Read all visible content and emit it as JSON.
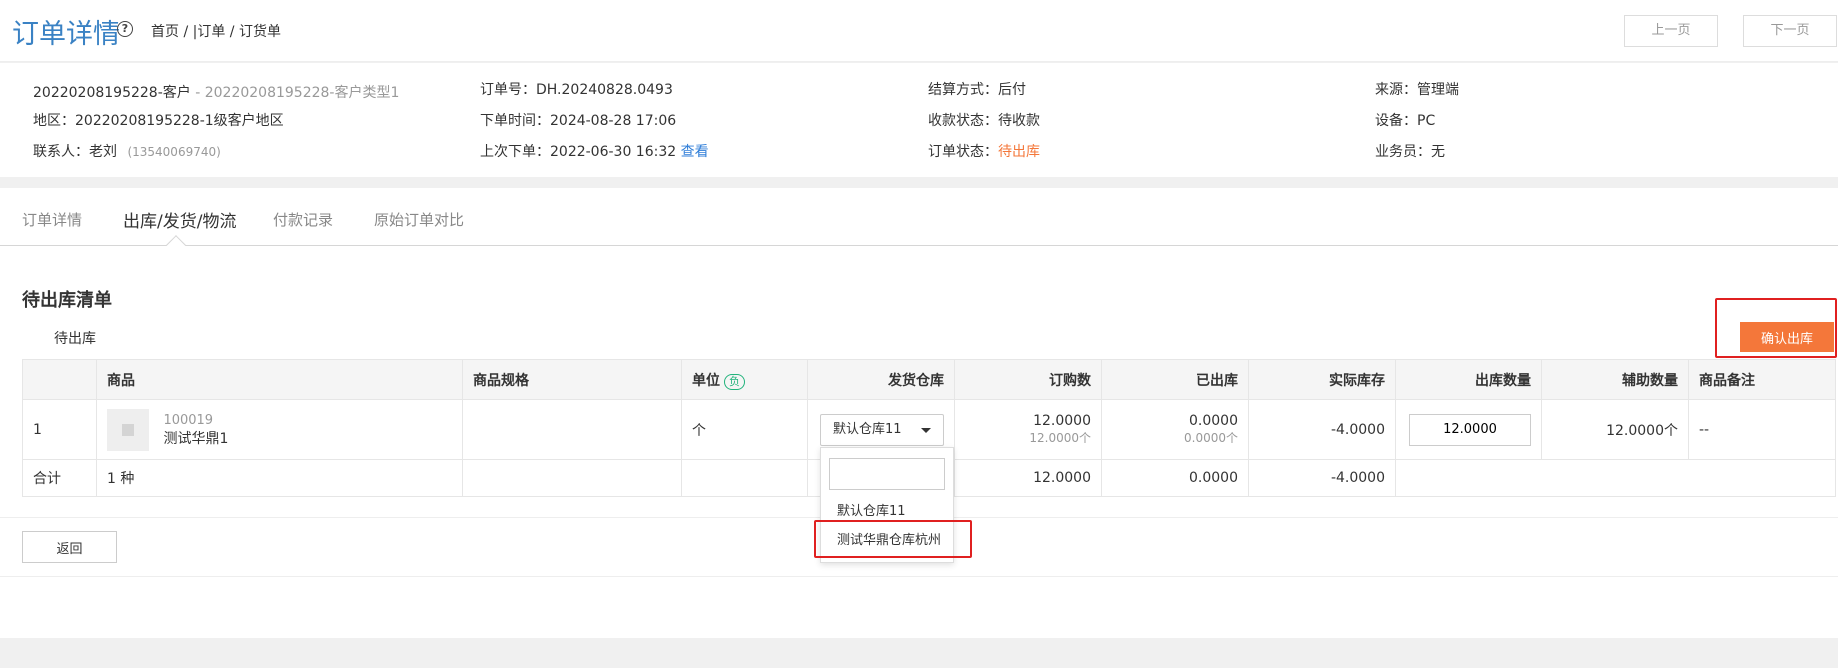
{
  "header": {
    "title": "订单详情",
    "breadcrumb": "首页 / |订单 / 订货单",
    "prev_label": "上一页",
    "next_label": "下一页"
  },
  "info": {
    "customer": "20220208195228-客户",
    "customer_type": " - 20220208195228-客户类型1",
    "region": "地区：20220208195228-1级客户地区",
    "contact_label": "联系人：老刘",
    "contact_phone": "(13540069740)",
    "order_no": "订单号：DH.20240828.0493",
    "order_time": "下单时间：2024-08-28 17:06",
    "last_order": "上次下单：2022-06-30 16:32",
    "last_order_link": "查看",
    "settlement": "结算方式：后付",
    "payment_status": "收款状态：待收款",
    "order_status_label": "订单状态：",
    "order_status_value": "待出库",
    "source": "来源：管理端",
    "device": "设备：PC",
    "salesperson": "业务员：无"
  },
  "tabs": [
    "订单详情",
    "出库/发货/物流",
    "付款记录",
    "原始订单对比"
  ],
  "section": {
    "title": "待出库清单",
    "sub_label": "待出库",
    "confirm_label": "确认出库"
  },
  "table": {
    "headers": [
      "",
      "商品",
      "商品规格",
      "单位",
      "发货仓库",
      "订购数",
      "已出库",
      "实际库存",
      "出库数量",
      "辅助数量",
      "商品备注"
    ],
    "unit_tag": "负",
    "row": {
      "index": "1",
      "code": "100019",
      "name": "测试华鼎1",
      "spec": "",
      "unit": "个",
      "warehouse": "默认仓库11",
      "ordered": "12.0000",
      "ordered_sub": "12.0000个",
      "shipped": "0.0000",
      "shipped_sub": "0.0000个",
      "stock": "-4.0000",
      "out_qty": "12.0000",
      "aux_qty": "12.0000个",
      "remark": "--"
    },
    "summary": {
      "label": "合计",
      "kinds": "1 种",
      "ordered": "12.0000",
      "shipped": "0.0000",
      "stock": "-4.0000"
    }
  },
  "dropdown": {
    "options": [
      "默认仓库11",
      "测试华鼎仓库杭州"
    ]
  },
  "footer": {
    "back_label": "返回"
  },
  "colors": {
    "accent": "#3a82c4",
    "orange": "#f4773a",
    "highlight": "#e02020",
    "unit_tag": "#22b37c"
  }
}
